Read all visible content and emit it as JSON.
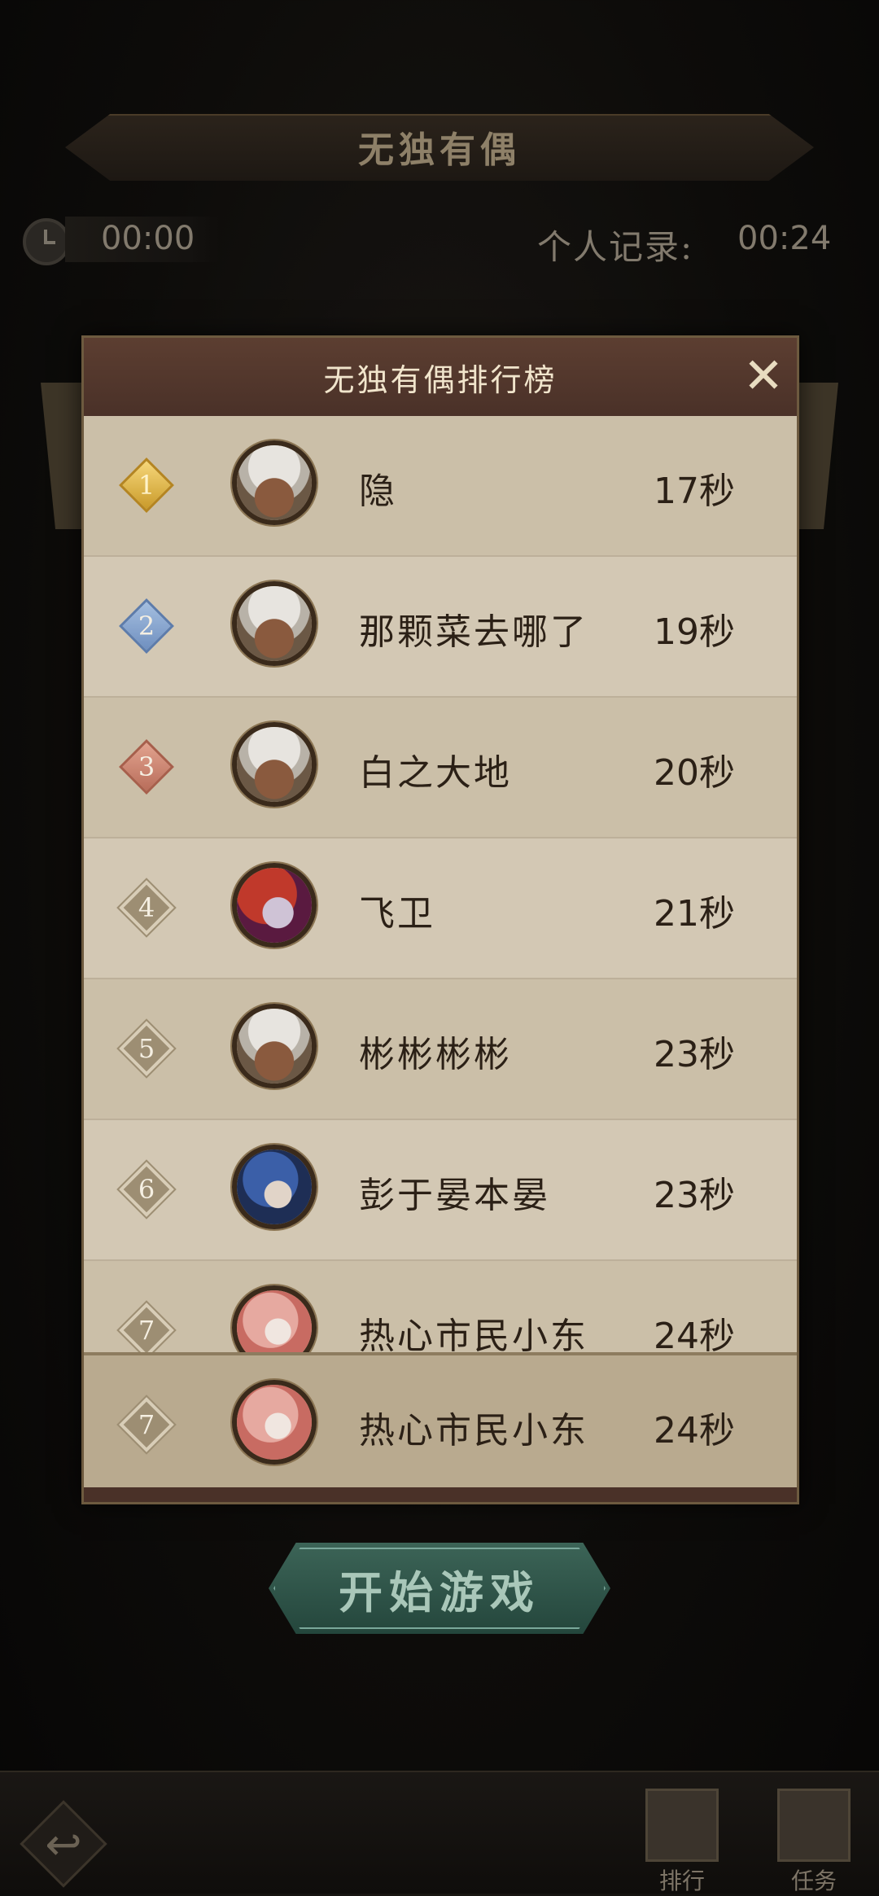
{
  "page": {
    "title": "无独有偶",
    "timer": "00:00",
    "record_label": "个人记录:",
    "record_value": "00:24",
    "start_button": "开始游戏"
  },
  "modal": {
    "title": "无独有偶排行榜",
    "close_icon": "close-icon"
  },
  "leaderboard": [
    {
      "rank": "1",
      "medal": "gold",
      "avatar": "white-hair",
      "name": "隐",
      "time": "17秒"
    },
    {
      "rank": "2",
      "medal": "silver",
      "avatar": "white-hair",
      "name": "那颗菜去哪了",
      "time": "19秒"
    },
    {
      "rank": "3",
      "medal": "bronze",
      "avatar": "white-hair",
      "name": "白之大地",
      "time": "20秒"
    },
    {
      "rank": "4",
      "medal": "plain",
      "avatar": "red-hair",
      "name": "飞卫",
      "time": "21秒"
    },
    {
      "rank": "5",
      "medal": "plain",
      "avatar": "white-hair",
      "name": "彬彬彬彬",
      "time": "23秒"
    },
    {
      "rank": "6",
      "medal": "plain",
      "avatar": "blue-hair",
      "name": "彭于晏本晏",
      "time": "23秒"
    },
    {
      "rank": "7",
      "medal": "plain",
      "avatar": "pink-hair",
      "name": "热心市民小东",
      "time": "24秒"
    }
  ],
  "self_entry": {
    "rank": "7",
    "avatar": "pink-hair",
    "name": "热心市民小东",
    "time": "24秒"
  },
  "bottom_nav": {
    "back_icon": "back-arrow-icon",
    "ranking_label": "排行",
    "task_label": "任务"
  }
}
